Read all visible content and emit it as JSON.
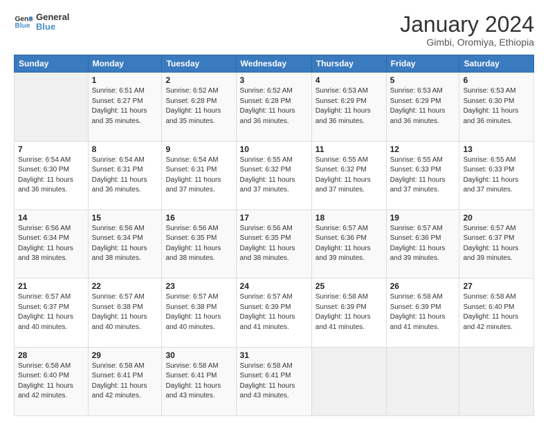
{
  "logo": {
    "line1": "General",
    "line2": "Blue"
  },
  "title": "January 2024",
  "subtitle": "Gimbi, Oromiya, Ethiopia",
  "columns": [
    "Sunday",
    "Monday",
    "Tuesday",
    "Wednesday",
    "Thursday",
    "Friday",
    "Saturday"
  ],
  "weeks": [
    [
      {
        "day": "",
        "detail": ""
      },
      {
        "day": "1",
        "detail": "Sunrise: 6:51 AM\nSunset: 6:27 PM\nDaylight: 11 hours\nand 35 minutes."
      },
      {
        "day": "2",
        "detail": "Sunrise: 6:52 AM\nSunset: 6:28 PM\nDaylight: 11 hours\nand 35 minutes."
      },
      {
        "day": "3",
        "detail": "Sunrise: 6:52 AM\nSunset: 6:28 PM\nDaylight: 11 hours\nand 36 minutes."
      },
      {
        "day": "4",
        "detail": "Sunrise: 6:53 AM\nSunset: 6:29 PM\nDaylight: 11 hours\nand 36 minutes."
      },
      {
        "day": "5",
        "detail": "Sunrise: 6:53 AM\nSunset: 6:29 PM\nDaylight: 11 hours\nand 36 minutes."
      },
      {
        "day": "6",
        "detail": "Sunrise: 6:53 AM\nSunset: 6:30 PM\nDaylight: 11 hours\nand 36 minutes."
      }
    ],
    [
      {
        "day": "7",
        "detail": "Sunrise: 6:54 AM\nSunset: 6:30 PM\nDaylight: 11 hours\nand 36 minutes."
      },
      {
        "day": "8",
        "detail": "Sunrise: 6:54 AM\nSunset: 6:31 PM\nDaylight: 11 hours\nand 36 minutes."
      },
      {
        "day": "9",
        "detail": "Sunrise: 6:54 AM\nSunset: 6:31 PM\nDaylight: 11 hours\nand 37 minutes."
      },
      {
        "day": "10",
        "detail": "Sunrise: 6:55 AM\nSunset: 6:32 PM\nDaylight: 11 hours\nand 37 minutes."
      },
      {
        "day": "11",
        "detail": "Sunrise: 6:55 AM\nSunset: 6:32 PM\nDaylight: 11 hours\nand 37 minutes."
      },
      {
        "day": "12",
        "detail": "Sunrise: 6:55 AM\nSunset: 6:33 PM\nDaylight: 11 hours\nand 37 minutes."
      },
      {
        "day": "13",
        "detail": "Sunrise: 6:55 AM\nSunset: 6:33 PM\nDaylight: 11 hours\nand 37 minutes."
      }
    ],
    [
      {
        "day": "14",
        "detail": "Sunrise: 6:56 AM\nSunset: 6:34 PM\nDaylight: 11 hours\nand 38 minutes."
      },
      {
        "day": "15",
        "detail": "Sunrise: 6:56 AM\nSunset: 6:34 PM\nDaylight: 11 hours\nand 38 minutes."
      },
      {
        "day": "16",
        "detail": "Sunrise: 6:56 AM\nSunset: 6:35 PM\nDaylight: 11 hours\nand 38 minutes."
      },
      {
        "day": "17",
        "detail": "Sunrise: 6:56 AM\nSunset: 6:35 PM\nDaylight: 11 hours\nand 38 minutes."
      },
      {
        "day": "18",
        "detail": "Sunrise: 6:57 AM\nSunset: 6:36 PM\nDaylight: 11 hours\nand 39 minutes."
      },
      {
        "day": "19",
        "detail": "Sunrise: 6:57 AM\nSunset: 6:36 PM\nDaylight: 11 hours\nand 39 minutes."
      },
      {
        "day": "20",
        "detail": "Sunrise: 6:57 AM\nSunset: 6:37 PM\nDaylight: 11 hours\nand 39 minutes."
      }
    ],
    [
      {
        "day": "21",
        "detail": "Sunrise: 6:57 AM\nSunset: 6:37 PM\nDaylight: 11 hours\nand 40 minutes."
      },
      {
        "day": "22",
        "detail": "Sunrise: 6:57 AM\nSunset: 6:38 PM\nDaylight: 11 hours\nand 40 minutes."
      },
      {
        "day": "23",
        "detail": "Sunrise: 6:57 AM\nSunset: 6:38 PM\nDaylight: 11 hours\nand 40 minutes."
      },
      {
        "day": "24",
        "detail": "Sunrise: 6:57 AM\nSunset: 6:39 PM\nDaylight: 11 hours\nand 41 minutes."
      },
      {
        "day": "25",
        "detail": "Sunrise: 6:58 AM\nSunset: 6:39 PM\nDaylight: 11 hours\nand 41 minutes."
      },
      {
        "day": "26",
        "detail": "Sunrise: 6:58 AM\nSunset: 6:39 PM\nDaylight: 11 hours\nand 41 minutes."
      },
      {
        "day": "27",
        "detail": "Sunrise: 6:58 AM\nSunset: 6:40 PM\nDaylight: 11 hours\nand 42 minutes."
      }
    ],
    [
      {
        "day": "28",
        "detail": "Sunrise: 6:58 AM\nSunset: 6:40 PM\nDaylight: 11 hours\nand 42 minutes."
      },
      {
        "day": "29",
        "detail": "Sunrise: 6:58 AM\nSunset: 6:41 PM\nDaylight: 11 hours\nand 42 minutes."
      },
      {
        "day": "30",
        "detail": "Sunrise: 6:58 AM\nSunset: 6:41 PM\nDaylight: 11 hours\nand 43 minutes."
      },
      {
        "day": "31",
        "detail": "Sunrise: 6:58 AM\nSunset: 6:41 PM\nDaylight: 11 hours\nand 43 minutes."
      },
      {
        "day": "",
        "detail": ""
      },
      {
        "day": "",
        "detail": ""
      },
      {
        "day": "",
        "detail": ""
      }
    ]
  ]
}
